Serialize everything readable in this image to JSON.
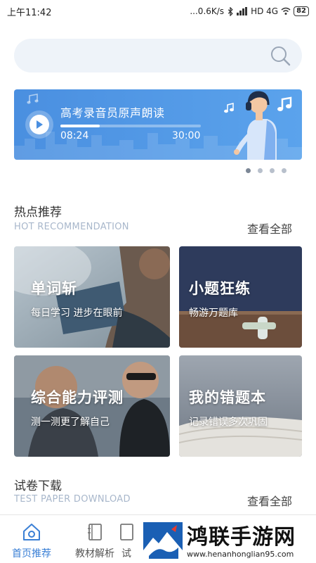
{
  "status_bar": {
    "time": "上午11:42",
    "network_speed": "...0.6K/s",
    "bluetooth_icon": "bluetooth-icon",
    "signal": "HD 4G",
    "battery": "82"
  },
  "search": {
    "icon": "search-icon"
  },
  "banner": {
    "title": "高考录音员原声朗读",
    "current_time": "08:24",
    "total_time": "30:00",
    "progress": 0.28,
    "dots_count": 4,
    "active_dot": 0
  },
  "hot_section": {
    "title": "热点推荐",
    "subtitle": "HOT RECOMMENDATION",
    "more": "查看全部",
    "cards": [
      {
        "title": "单词斩",
        "subtitle": "每日学习 进步在眼前"
      },
      {
        "title": "小题狂练",
        "subtitle": "畅游万题库"
      },
      {
        "title": "综合能力评测",
        "subtitle": "测一测更了解自己"
      },
      {
        "title": "我的错题本",
        "subtitle": "记录错误多次巩固"
      }
    ]
  },
  "paper_section": {
    "title": "试卷下载",
    "subtitle": "TEST PAPER DOWNLOAD",
    "more": "查看全部"
  },
  "bottom_nav": {
    "items": [
      {
        "label": "首页推荐",
        "icon": "home-icon",
        "active": true
      },
      {
        "label": "教材解析",
        "icon": "book-icon",
        "active": false
      },
      {
        "label": "试",
        "icon": "paper-icon",
        "active": false
      }
    ]
  },
  "watermark": {
    "title": "鸿联手游网",
    "url": "www.henanhonglian95.com"
  },
  "colors": {
    "accent": "#3a7fd5",
    "banner_blue": "#4a8fe0",
    "subtitle_gray": "#a8b7cb"
  }
}
